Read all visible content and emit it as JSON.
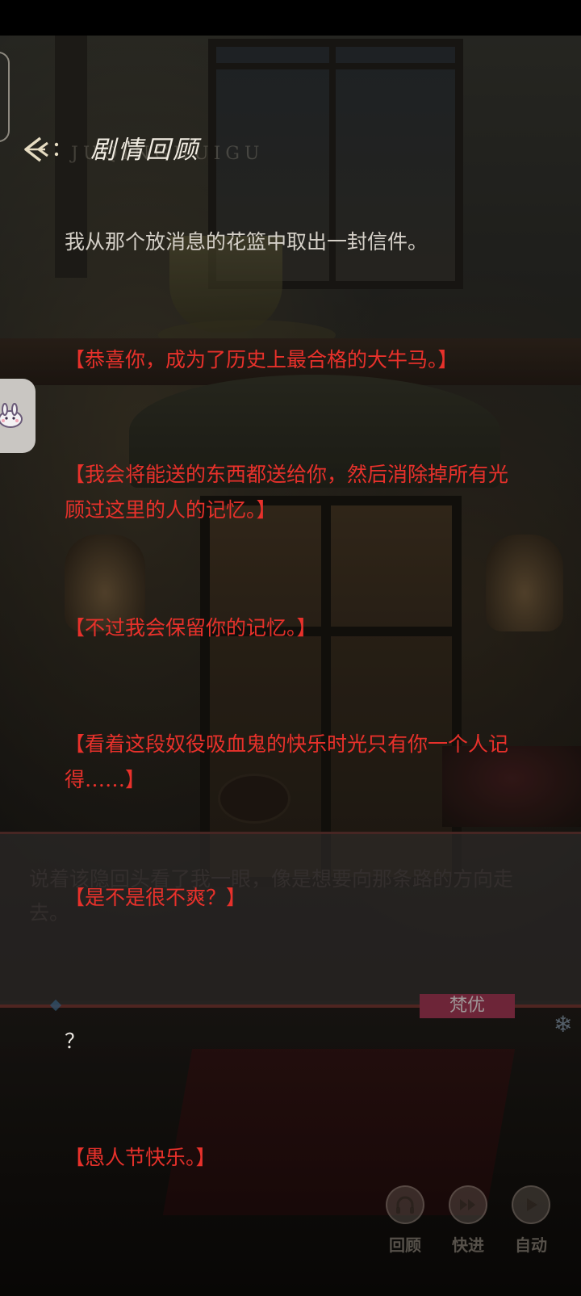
{
  "header": {
    "title": "剧情回顾",
    "pinyin_watermark": "JUQINGHUIGU"
  },
  "log": [
    {
      "type": "narration",
      "text": "我从那个放消息的花篮中取出一封信件。"
    },
    {
      "type": "letter",
      "text": "【恭喜你，成为了历史上最合格的大牛马。】"
    },
    {
      "type": "letter",
      "text": "【我会将能送的东西都送给你，然后消除掉所有光顾过这里的人的记忆。】"
    },
    {
      "type": "letter",
      "text": "【不过我会保留你的记忆。】"
    },
    {
      "type": "letter",
      "text": "【看着这段奴役吸血鬼的快乐时光只有你一个人记得……】"
    },
    {
      "type": "letter",
      "text": "【是不是很不爽？】"
    },
    {
      "type": "plain",
      "text": "？"
    },
    {
      "type": "letter",
      "text": "【愚人节快乐。】"
    }
  ],
  "dialog": {
    "text": "说着该隐回头看了我一眼，像是想要向那条路的方向走去。",
    "speaker": "梵优"
  },
  "controls": [
    {
      "id": "review",
      "label": "回顾",
      "icon": "headphones-icon"
    },
    {
      "id": "skip",
      "label": "快进",
      "icon": "fast-forward-icon"
    },
    {
      "id": "auto",
      "label": "自动",
      "icon": "play-icon"
    }
  ],
  "colors": {
    "letter_text": "#e8312b",
    "narration_text": "#d5d0c8",
    "speaker_tag": "#a83a56"
  }
}
